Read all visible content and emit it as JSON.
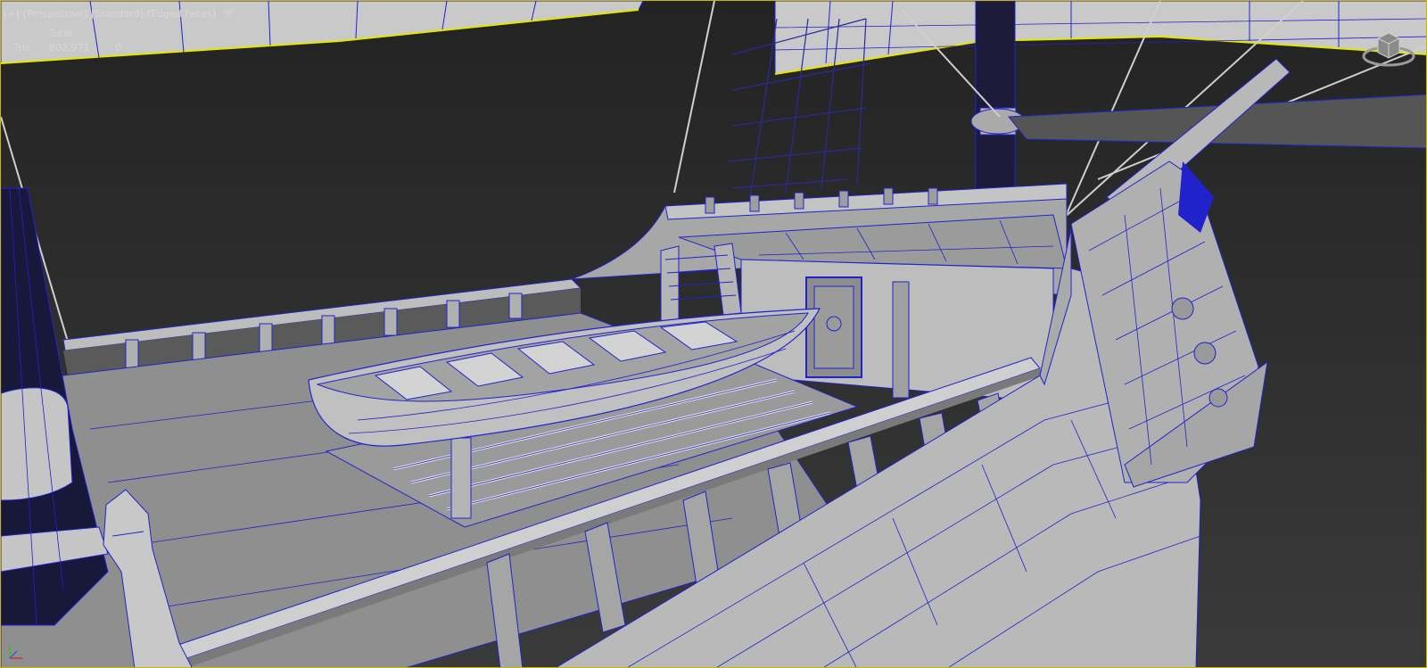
{
  "viewport": {
    "labels": [
      "[+]",
      "[Perspective]",
      "[Standard]",
      "[Edged Faces]"
    ],
    "filter_icon": "funnel-icon"
  },
  "stats": {
    "header": "Total",
    "tris_label": "Tris:",
    "tris_total": "802,971",
    "tris_selected": "0"
  },
  "colors": {
    "background": "#2b2b2b",
    "wire": "#2222cc",
    "surface": "#a9a9a9",
    "selection": "#e6e600",
    "border": "#c8b600"
  },
  "icons": [
    "viewcube-icon",
    "axis-tripod-icon"
  ]
}
